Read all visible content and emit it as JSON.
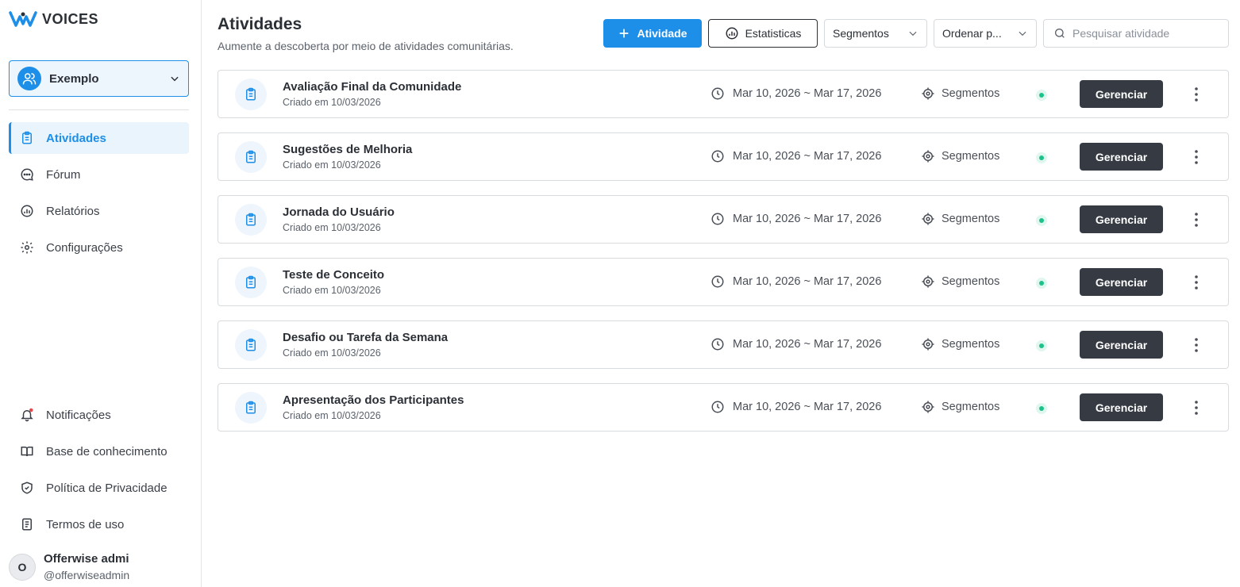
{
  "app": {
    "brand": "VOICES"
  },
  "workspace": {
    "name": "Exemplo"
  },
  "sidebar": {
    "items": [
      {
        "label": "Atividades",
        "icon": "clipboard-icon",
        "active": true
      },
      {
        "label": "Fórum",
        "icon": "chat-icon",
        "active": false
      },
      {
        "label": "Relatórios",
        "icon": "chart-icon",
        "active": false
      },
      {
        "label": "Configurações",
        "icon": "gear-icon",
        "active": false
      }
    ],
    "bottom_items": [
      {
        "label": "Notificações",
        "icon": "bell-icon",
        "has_badge": true
      },
      {
        "label": "Base de conhecimento",
        "icon": "book-icon"
      },
      {
        "label": "Política de Privacidade",
        "icon": "shield-icon"
      },
      {
        "label": "Termos de uso",
        "icon": "document-icon"
      }
    ]
  },
  "user": {
    "initial": "O",
    "name": "Offerwise admi",
    "handle": "@offerwiseadmin"
  },
  "header": {
    "title": "Atividades",
    "subtitle": "Aumente a descoberta por meio de atividades comunitárias."
  },
  "toolbar": {
    "add_label": "Atividade",
    "stats_label": "Estatisticas",
    "segments_label": "Segmentos",
    "sort_label": "Ordenar p...",
    "search_placeholder": "Pesquisar atividade"
  },
  "activities": [
    {
      "title": "Avaliação Final da Comunidade",
      "created": "Criado em 10/03/2026",
      "dates": "Mar 10, 2026 ~ Mar 17, 2026",
      "segments": "Segmentos",
      "manage": "Gerenciar"
    },
    {
      "title": "Sugestões de Melhoria",
      "created": "Criado em 10/03/2026",
      "dates": "Mar 10, 2026 ~ Mar 17, 2026",
      "segments": "Segmentos",
      "manage": "Gerenciar"
    },
    {
      "title": "Jornada do Usuário",
      "created": "Criado em 10/03/2026",
      "dates": "Mar 10, 2026 ~ Mar 17, 2026",
      "segments": "Segmentos",
      "manage": "Gerenciar"
    },
    {
      "title": "Teste de Conceito",
      "created": "Criado em 10/03/2026",
      "dates": "Mar 10, 2026 ~ Mar 17, 2026",
      "segments": "Segmentos",
      "manage": "Gerenciar"
    },
    {
      "title": "Desafio ou Tarefa da Semana",
      "created": "Criado em 10/03/2026",
      "dates": "Mar 10, 2026 ~ Mar 17, 2026",
      "segments": "Segmentos",
      "manage": "Gerenciar"
    },
    {
      "title": "Apresentação dos Participantes",
      "created": "Criado em 10/03/2026",
      "dates": "Mar 10, 2026 ~ Mar 17, 2026",
      "segments": "Segmentos",
      "manage": "Gerenciar"
    }
  ],
  "colors": {
    "accent": "#1d8fe8",
    "dark_button": "#353a43",
    "status_active": "#1cc28a"
  }
}
